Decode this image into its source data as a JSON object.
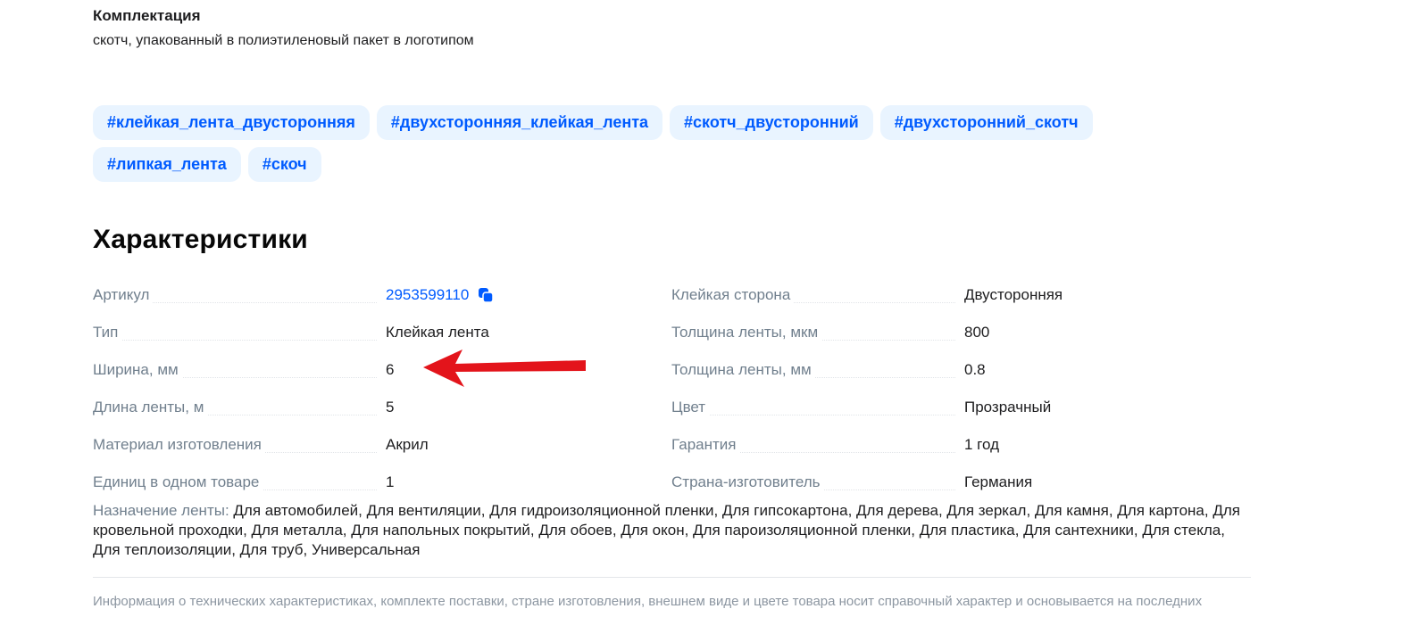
{
  "kit": {
    "title": "Комплектация",
    "text": "скотч, упакованный в полиэтиленовый пакет в логотипом"
  },
  "tags": [
    [
      "#клейкая_лента_двусторонняя",
      "#двухсторонняя_клейкая_лента",
      "#скотч_двусторонний",
      "#двухсторонний_скотч"
    ],
    [
      "#липкая_лента",
      "#скоч"
    ]
  ],
  "specs": {
    "title": "Характеристики",
    "left": [
      {
        "key": "Артикул",
        "value": "2953599110"
      },
      {
        "key": "Тип",
        "value": "Клейкая лента"
      },
      {
        "key": "Ширина, мм",
        "value": "6"
      },
      {
        "key": "Длина ленты, м",
        "value": "5"
      },
      {
        "key": "Материал изготовления",
        "value": "Акрил"
      },
      {
        "key": "Единиц в одном товаре",
        "value": "1"
      }
    ],
    "right": [
      {
        "key": "Клейкая сторона",
        "value": "Двусторонняя"
      },
      {
        "key": "Толщина ленты, мкм",
        "value": "800"
      },
      {
        "key": "Толщина ленты, мм",
        "value": "0.8"
      },
      {
        "key": "Цвет",
        "value": "Прозрачный"
      },
      {
        "key": "Гарантия",
        "value": "1 год"
      },
      {
        "key": "Страна-изготовитель",
        "value": "Германия"
      }
    ],
    "purpose_key": "Назначение ленты:",
    "purpose_value": "Для автомобилей, Для вентиляции, Для гидроизоляционной пленки, Для гипсокартона, Для дерева, Для зеркал, Для камня, Для картона, Для кровельной проходки, Для металла, Для напольных покрытий, Для обоев, Для окон, Для пароизоляционной пленки, Для пластика, Для сантехники, Для стекла, Для теплоизоляции, Для труб, Универсальная"
  },
  "disclaimer": "Информация о технических характеристиках, комплекте поставки, стране изготовления, внешнем виде и цвете товара носит справочный характер и основывается на последних",
  "colors": {
    "accent": "#005bff",
    "tag_bg": "#e9f4ff",
    "label_gray": "#707f8d",
    "annotation_arrow": "#e3141b"
  },
  "icons": {
    "copy": "copy-icon",
    "annotation": "red-arrow-annotation"
  }
}
